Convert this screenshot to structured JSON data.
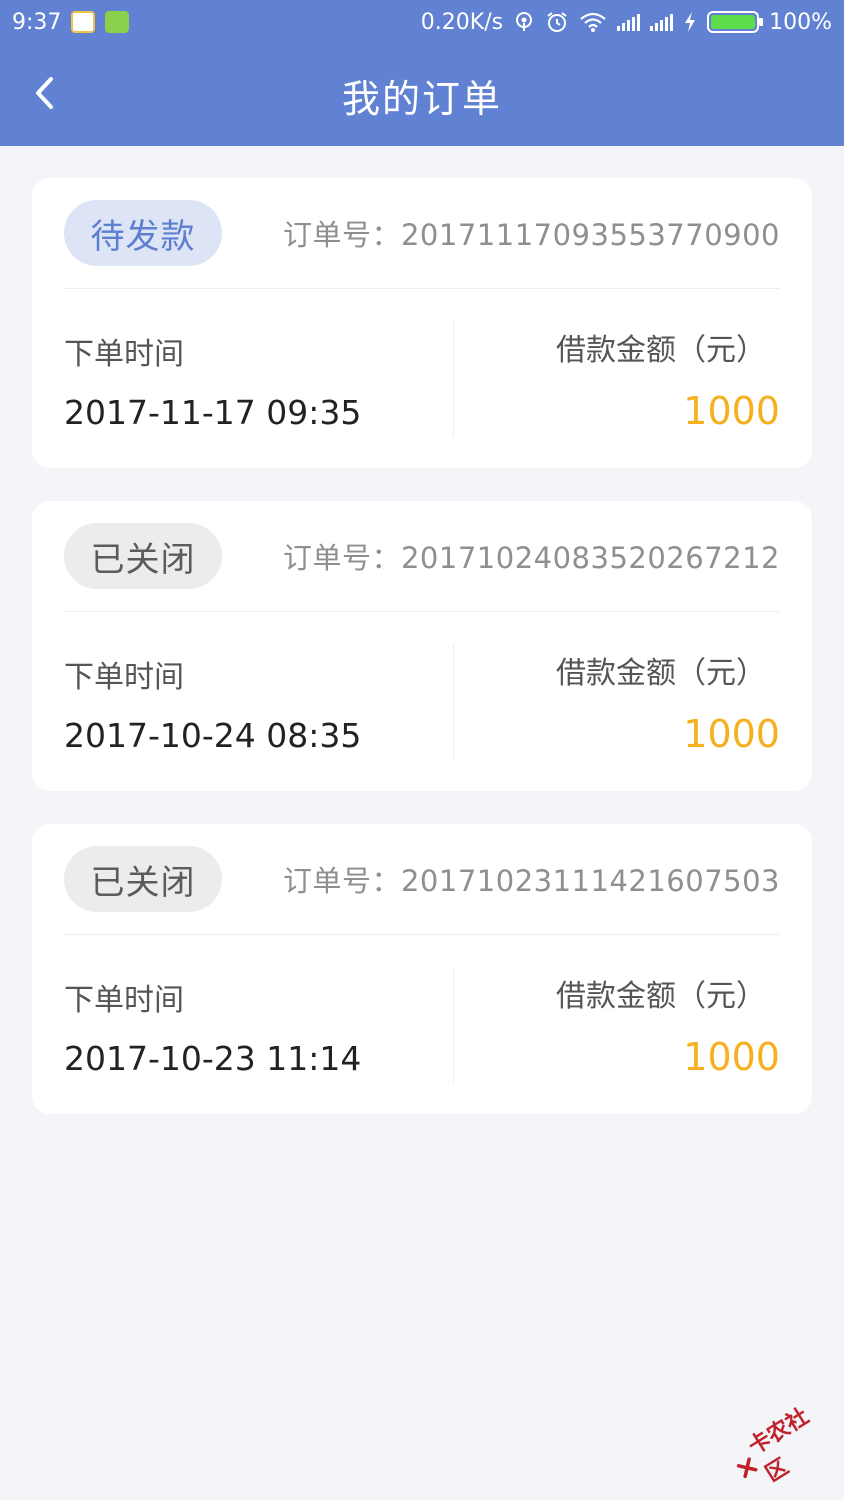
{
  "status_bar": {
    "time": "9:37",
    "net_speed": "0.20K/s",
    "battery": "100%",
    "icons": [
      "app-icon",
      "app-icon",
      "hotspot-icon",
      "alarm-icon",
      "wifi-icon",
      "signal-icon",
      "signal-icon",
      "charging-icon",
      "battery-icon"
    ]
  },
  "header": {
    "title": "我的订单",
    "back_icon": "chevron-left-icon"
  },
  "orders": [
    {
      "status": "待发款",
      "order_no": "订单号：20171117093553770900",
      "time_label": "下单时间",
      "time": "2017-11-17 09:35",
      "amount_label": "借款金额（元）",
      "amount": "1000"
    },
    {
      "status": "已关闭",
      "order_no": "订单号：20171024083520267212",
      "time_label": "下单时间",
      "time": "2017-10-24 08:35",
      "amount_label": "借款金额（元）",
      "amount": "1000"
    },
    {
      "status": "已关闭",
      "order_no": "订单号：20171023111421607503",
      "time_label": "下单时间",
      "time": "2017-10-23 11:14",
      "amount_label": "借款金额（元）",
      "amount": "1000"
    }
  ],
  "colors": {
    "header": "#6181d2",
    "amount": "#f6b01f",
    "pending_pill": "#dde4f6",
    "closed_pill": "#ececec"
  },
  "watermark": "卡农社区"
}
